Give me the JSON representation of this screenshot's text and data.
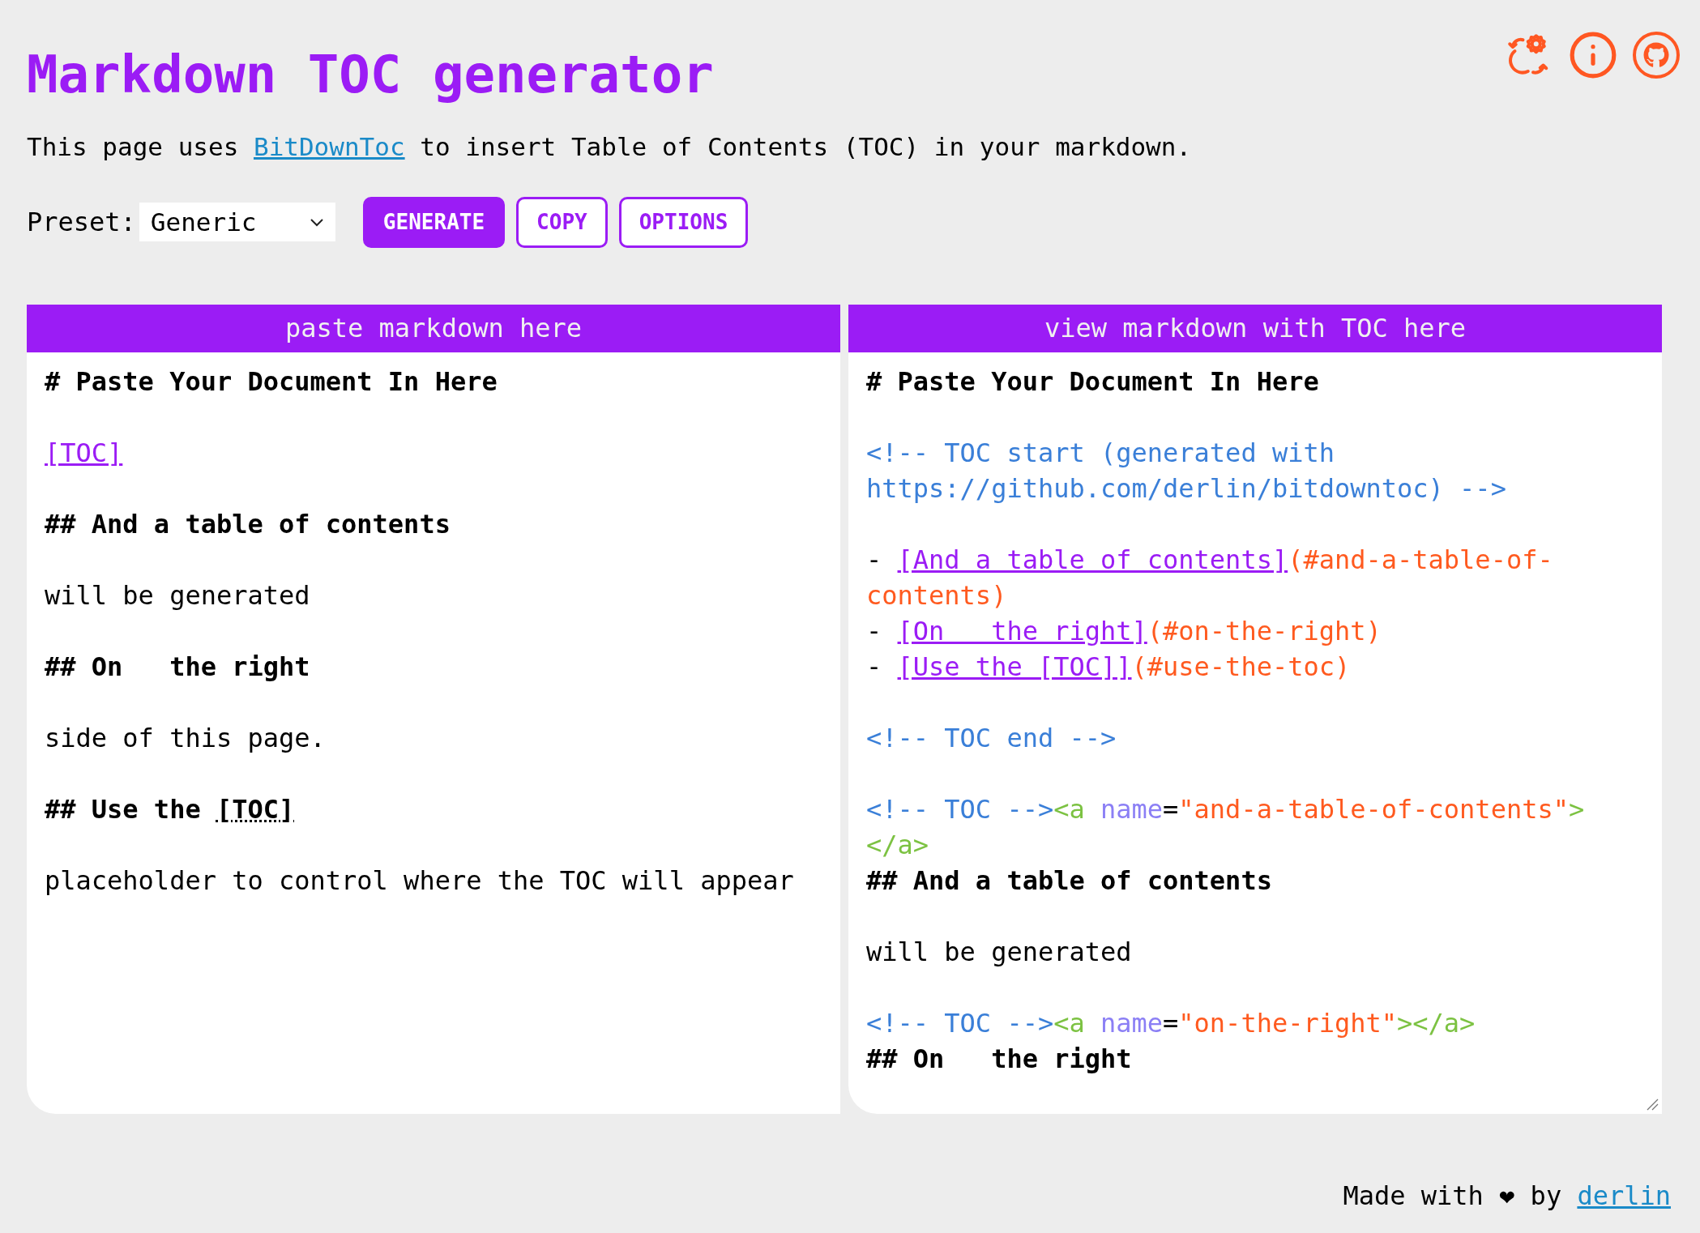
{
  "header": {
    "title": "Markdown TOC generator",
    "intro": "This page uses ",
    "intro_link": "BitDownToc",
    "intro_rest": " to insert Table of Contents (TOC) in your markdown.",
    "icons": [
      {
        "kind": "theme"
      },
      {
        "kind": "info"
      },
      {
        "kind": "github"
      }
    ]
  },
  "toolbar": {
    "preset_label": "Preset:",
    "preset_value": "Generic",
    "buttons": [
      {
        "label": "GENERATE",
        "primary": true
      },
      {
        "label": "COPY",
        "primary": false
      },
      {
        "label": "OPTIONS",
        "primary": false
      }
    ]
  },
  "panes": [
    {
      "title": "paste markdown here",
      "resizable": false,
      "lines": [
        {
          "tokens": [
            {
              "kind": "heading",
              "text": "# Paste Your Document In Here"
            }
          ]
        },
        {
          "kind": "blank"
        },
        {
          "tokens": [
            {
              "kind": "link",
              "text": "[TOC]"
            }
          ]
        },
        {
          "kind": "blank"
        },
        {
          "tokens": [
            {
              "kind": "heading",
              "text": "## And a table of contents"
            }
          ]
        },
        {
          "kind": "blank"
        },
        {
          "tokens": [
            {
              "kind": "text",
              "text": "will be generated"
            }
          ]
        },
        {
          "kind": "blank"
        },
        {
          "tokens": [
            {
              "kind": "heading",
              "text": "## On   the right"
            }
          ]
        },
        {
          "kind": "blank"
        },
        {
          "tokens": [
            {
              "kind": "text",
              "text": "side of this page."
            }
          ]
        },
        {
          "kind": "blank"
        },
        {
          "tokens": [
            {
              "kind": "heading",
              "text": "## Use the "
            },
            {
              "kind": "heading_link",
              "text": "[TOC]"
            }
          ]
        },
        {
          "kind": "blank"
        },
        {
          "tokens": [
            {
              "kind": "text",
              "text": "placeholder to control where the TOC will appear"
            }
          ]
        }
      ]
    },
    {
      "title": "view markdown with TOC here",
      "resizable": true,
      "lines": [
        {
          "tokens": [
            {
              "kind": "heading",
              "text": "# Paste Your Document In Here"
            }
          ]
        },
        {
          "kind": "blank"
        },
        {
          "tokens": [
            {
              "kind": "comment",
              "text": "<!-- TOC start (generated with https://github.com/derlin/bitdowntoc) -->"
            }
          ]
        },
        {
          "kind": "blank"
        },
        {
          "tokens": [
            {
              "kind": "text",
              "text": "- "
            },
            {
              "kind": "link",
              "text": "[And a table of contents]"
            },
            {
              "kind": "url",
              "text": "(#and-a-table-of-contents)"
            }
          ]
        },
        {
          "tokens": [
            {
              "kind": "text",
              "text": "- "
            },
            {
              "kind": "link",
              "text": "[On   the right]"
            },
            {
              "kind": "url",
              "text": "(#on-the-right)"
            }
          ]
        },
        {
          "tokens": [
            {
              "kind": "text",
              "text": "- "
            },
            {
              "kind": "link",
              "text": "[Use the [TOC]]"
            },
            {
              "kind": "url",
              "text": "(#use-the-toc)"
            }
          ]
        },
        {
          "kind": "blank"
        },
        {
          "tokens": [
            {
              "kind": "comment",
              "text": "<!-- TOC end -->"
            }
          ]
        },
        {
          "kind": "blank"
        },
        {
          "tokens": [
            {
              "kind": "comment",
              "text": "<!-- TOC -->"
            },
            {
              "kind": "tag",
              "text": "<a "
            },
            {
              "kind": "attr",
              "text": "name"
            },
            {
              "kind": "text",
              "text": "="
            },
            {
              "kind": "string",
              "text": "\"and-a-table-of-contents\""
            },
            {
              "kind": "tag",
              "text": ">"
            },
            {
              "kind": "tag",
              "text": "</a>"
            }
          ]
        },
        {
          "tokens": [
            {
              "kind": "heading",
              "text": "## And a table of contents"
            }
          ]
        },
        {
          "kind": "blank"
        },
        {
          "tokens": [
            {
              "kind": "text",
              "text": "will be generated"
            }
          ]
        },
        {
          "kind": "blank"
        },
        {
          "tokens": [
            {
              "kind": "comment",
              "text": "<!-- TOC -->"
            },
            {
              "kind": "tag",
              "text": "<a "
            },
            {
              "kind": "attr",
              "text": "name"
            },
            {
              "kind": "text",
              "text": "="
            },
            {
              "kind": "string",
              "text": "\"on-the-right\""
            },
            {
              "kind": "tag",
              "text": "></a>"
            }
          ]
        },
        {
          "tokens": [
            {
              "kind": "heading",
              "text": "## On   the right"
            }
          ]
        }
      ]
    }
  ],
  "footer": {
    "text": "Made with ❤ by ",
    "link": "derlin"
  }
}
